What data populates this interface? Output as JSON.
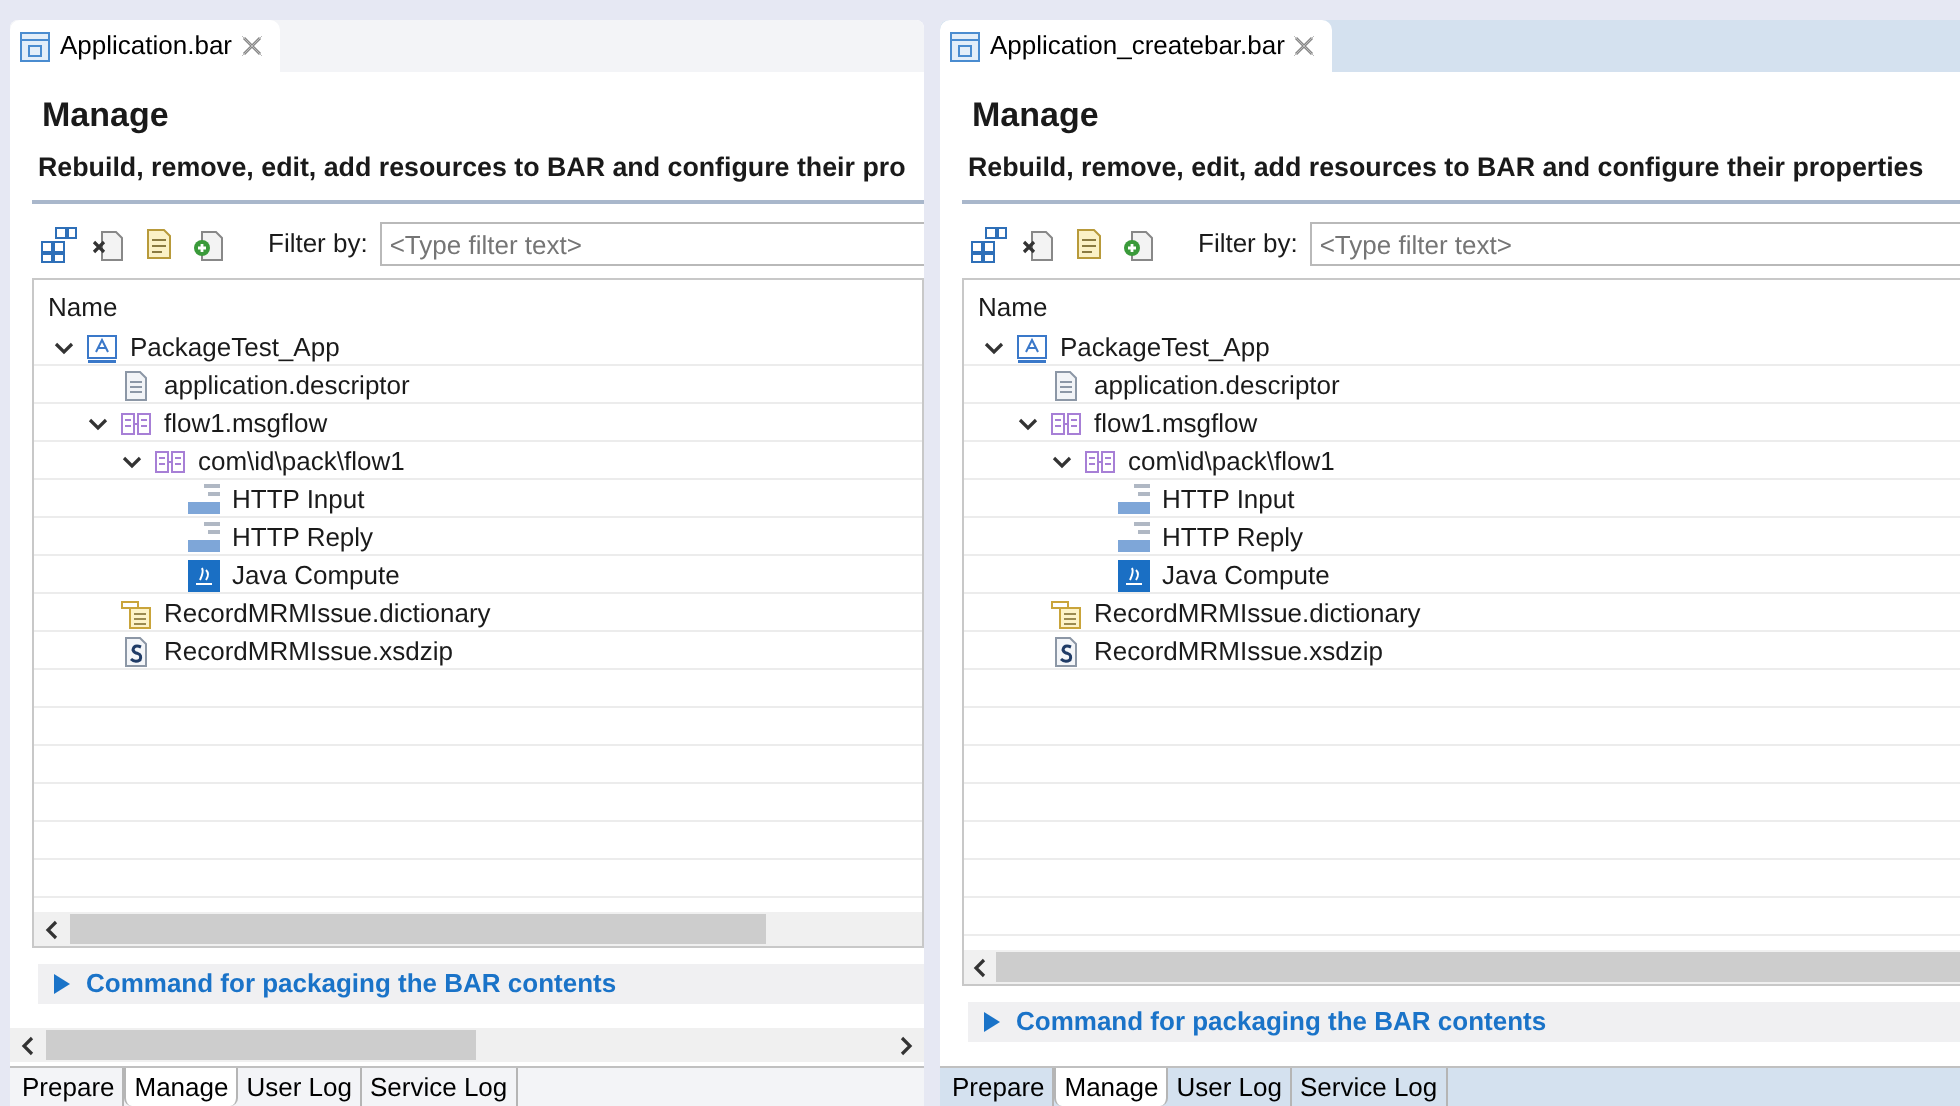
{
  "editors": [
    {
      "kind": "scrolled",
      "tab": {
        "title": "Application.bar",
        "selected": true
      },
      "heading": "Manage",
      "description": "Rebuild, remove, edit, add resources to BAR and configure their pro",
      "filter_label": "Filter by:",
      "filter": {
        "placeholder": "<Type filter text>"
      },
      "tree": {
        "column": "Name",
        "items": [
          {
            "label": "PackageTest_App",
            "kind": "application",
            "expanded": true,
            "children": [
              {
                "label": "application.descriptor",
                "kind": "descriptor"
              },
              {
                "label": "flow1.msgflow",
                "kind": "msgflow",
                "expanded": true,
                "children": [
                  {
                    "label": "com\\id\\pack\\flow1",
                    "kind": "msgflow",
                    "expanded": true,
                    "children": [
                      {
                        "label": "HTTP Input",
                        "kind": "http"
                      },
                      {
                        "label": "HTTP Reply",
                        "kind": "http"
                      },
                      {
                        "label": "Java Compute",
                        "kind": "java"
                      }
                    ]
                  }
                ]
              },
              {
                "label": "RecordMRMIssue.dictionary",
                "kind": "dictionary"
              },
              {
                "label": "RecordMRMIssue.xsdzip",
                "kind": "xsdzip"
              }
            ]
          }
        ]
      },
      "command_section": {
        "label": "Command for packaging the BAR contents",
        "expanded": false
      },
      "page_tabs": [
        {
          "label": "Prepare",
          "selected": false
        },
        {
          "label": "Manage",
          "selected": true
        },
        {
          "label": "User Log",
          "selected": false
        },
        {
          "label": "Service Log",
          "selected": false
        }
      ]
    },
    {
      "kind": "full",
      "tab": {
        "title": "Application_createbar.bar",
        "selected": true
      },
      "heading": "Manage",
      "description": "Rebuild, remove, edit, add resources to BAR and configure their properties",
      "filter_label": "Filter by:",
      "filter": {
        "placeholder": "<Type filter text>"
      },
      "tree": {
        "column": "Name",
        "items": [
          {
            "label": "PackageTest_App",
            "kind": "application",
            "expanded": true,
            "children": [
              {
                "label": "application.descriptor",
                "kind": "descriptor"
              },
              {
                "label": "flow1.msgflow",
                "kind": "msgflow",
                "expanded": true,
                "children": [
                  {
                    "label": "com\\id\\pack\\flow1",
                    "kind": "msgflow",
                    "expanded": true,
                    "children": [
                      {
                        "label": "HTTP Input",
                        "kind": "http"
                      },
                      {
                        "label": "HTTP Reply",
                        "kind": "http"
                      },
                      {
                        "label": "Java Compute",
                        "kind": "java"
                      }
                    ]
                  }
                ]
              },
              {
                "label": "RecordMRMIssue.dictionary",
                "kind": "dictionary"
              },
              {
                "label": "RecordMRMIssue.xsdzip",
                "kind": "xsdzip"
              }
            ]
          }
        ]
      },
      "command_section": {
        "label": "Command for packaging the BAR contents",
        "expanded": false
      },
      "page_tabs": [
        {
          "label": "Prepare",
          "selected": false
        },
        {
          "label": "Manage",
          "selected": true
        },
        {
          "label": "User Log",
          "selected": false
        },
        {
          "label": "Service Log",
          "selected": false
        }
      ]
    }
  ]
}
